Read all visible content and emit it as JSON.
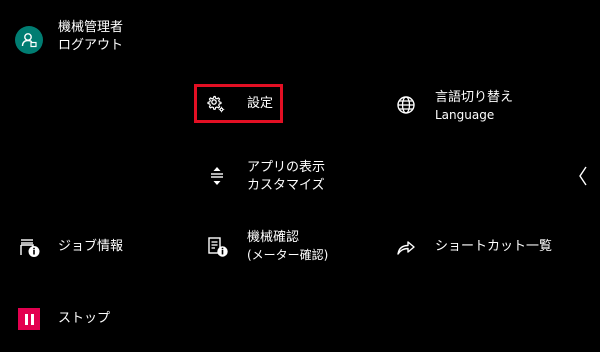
{
  "user": {
    "name": "機械管理者",
    "logout_label": "ログアウト"
  },
  "menu": {
    "settings": {
      "label": "設定",
      "icon": "gear-icon",
      "highlight_color": "#e30f23"
    },
    "language": {
      "label": "言語切り替え",
      "sublabel": "Language",
      "icon": "globe-icon"
    },
    "app_customize": {
      "line1": "アプリの表示",
      "line2": "カスタマイズ",
      "icon": "sort-arrows-icon"
    },
    "job_info": {
      "label": "ジョブ情報",
      "icon": "printer-info-icon"
    },
    "machine_check": {
      "line1": "機械確認",
      "line2": "(メーター確認)",
      "icon": "meter-info-icon"
    },
    "shortcut_list": {
      "label": "ショートカット一覧",
      "icon": "share-arrow-icon"
    },
    "stop": {
      "label": "ストップ",
      "icon": "pause-icon",
      "color": "#e3004f"
    }
  },
  "colors": {
    "background": "#000000",
    "avatar": "#007d72",
    "text": "#ffffff"
  }
}
